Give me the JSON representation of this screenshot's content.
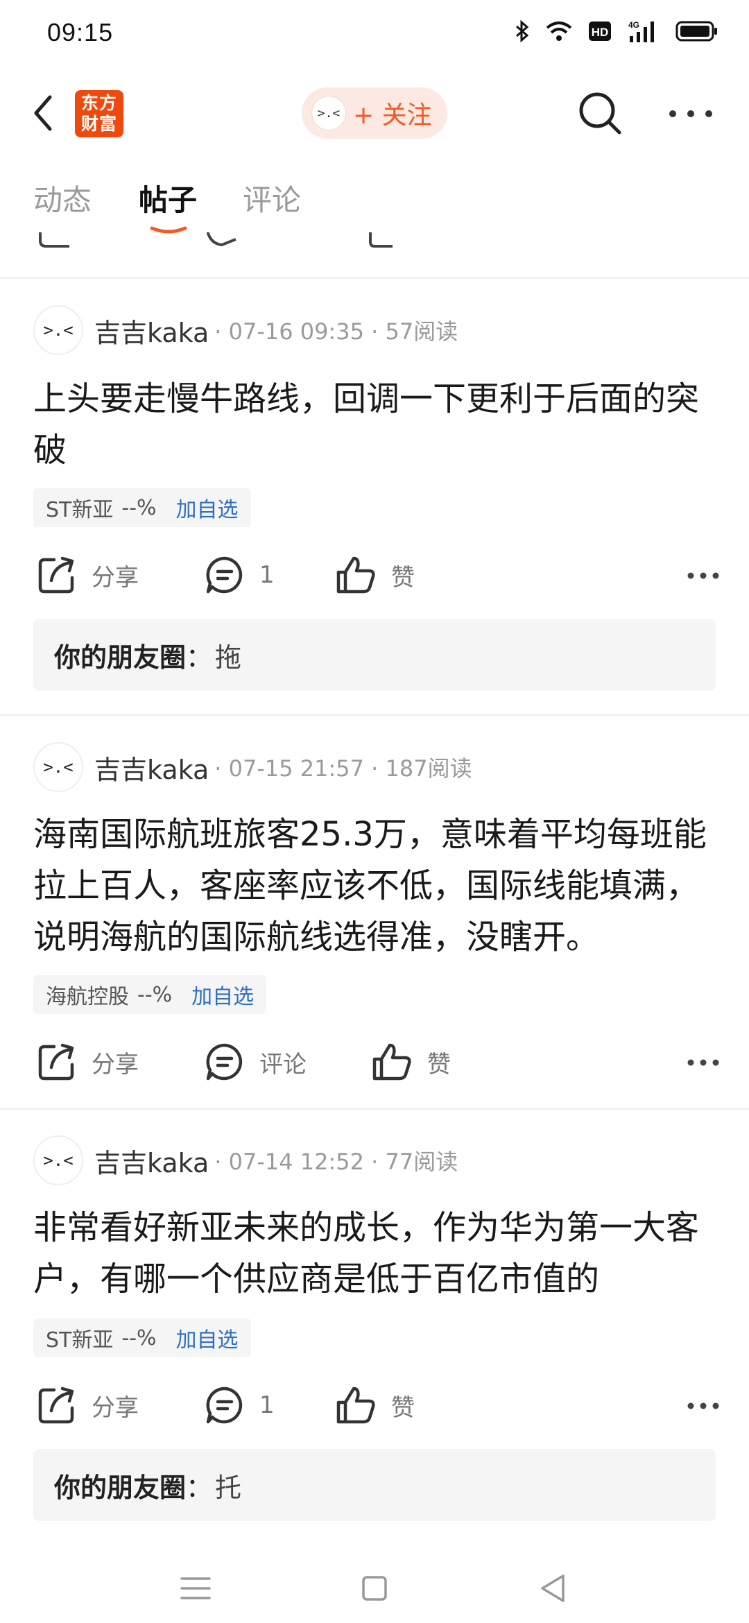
{
  "status_bar": {
    "time": "09:15",
    "icons": [
      "bluetooth-icon",
      "wifi-icon",
      "hd-icon",
      "signal-4g-icon",
      "battery-icon"
    ],
    "hd_label": "HD",
    "network_label": "4G"
  },
  "header": {
    "logo_line1": "东方",
    "logo_line2": "财富",
    "avatar_face": ">.<",
    "follow_label": "+ 关注",
    "brand_color": "#f0490d",
    "accent_color": "#f25a24"
  },
  "tabs": [
    {
      "label": "动态",
      "active": false
    },
    {
      "label": "帖子",
      "active": true
    },
    {
      "label": "评论",
      "active": false
    }
  ],
  "posts": [
    {
      "avatar_face": ">.<",
      "author": "吉吉kaka",
      "meta": "· 07-16 09:35 · 57阅读",
      "text": "上头要走慢牛路线，回调一下更利于后面的突破",
      "stock_name": "ST新亚",
      "stock_pct": "--%",
      "add_watch": "加自选",
      "share_label": "分享",
      "comment_label": "1",
      "like_label": "赞",
      "friends_label": "你的朋友圈",
      "friends_colon": "：",
      "friends_text": "拖"
    },
    {
      "avatar_face": ">.<",
      "author": "吉吉kaka",
      "meta": "· 07-15 21:57 · 187阅读",
      "text": "海南国际航班旅客25.3万，意味着平均每班能拉上百人，客座率应该不低，国际线能填满，说明海航的国际航线选得准，没瞎开。",
      "stock_name": "海航控股",
      "stock_pct": "--%",
      "add_watch": "加自选",
      "share_label": "分享",
      "comment_label": "评论",
      "like_label": "赞"
    },
    {
      "avatar_face": ">.<",
      "author": "吉吉kaka",
      "meta": "· 07-14 12:52 · 77阅读",
      "text": "非常看好新亚未来的成长，作为华为第一大客户，有哪一个供应商是低于百亿市值的",
      "stock_name": "ST新亚",
      "stock_pct": "--%",
      "add_watch": "加自选",
      "share_label": "分享",
      "comment_label": "1",
      "like_label": "赞",
      "friends_label": "你的朋友圈",
      "friends_colon": "：",
      "friends_text": "托"
    }
  ],
  "nav_bar": {
    "icons": [
      "menu-icon",
      "home-icon",
      "back-triangle-icon"
    ]
  }
}
